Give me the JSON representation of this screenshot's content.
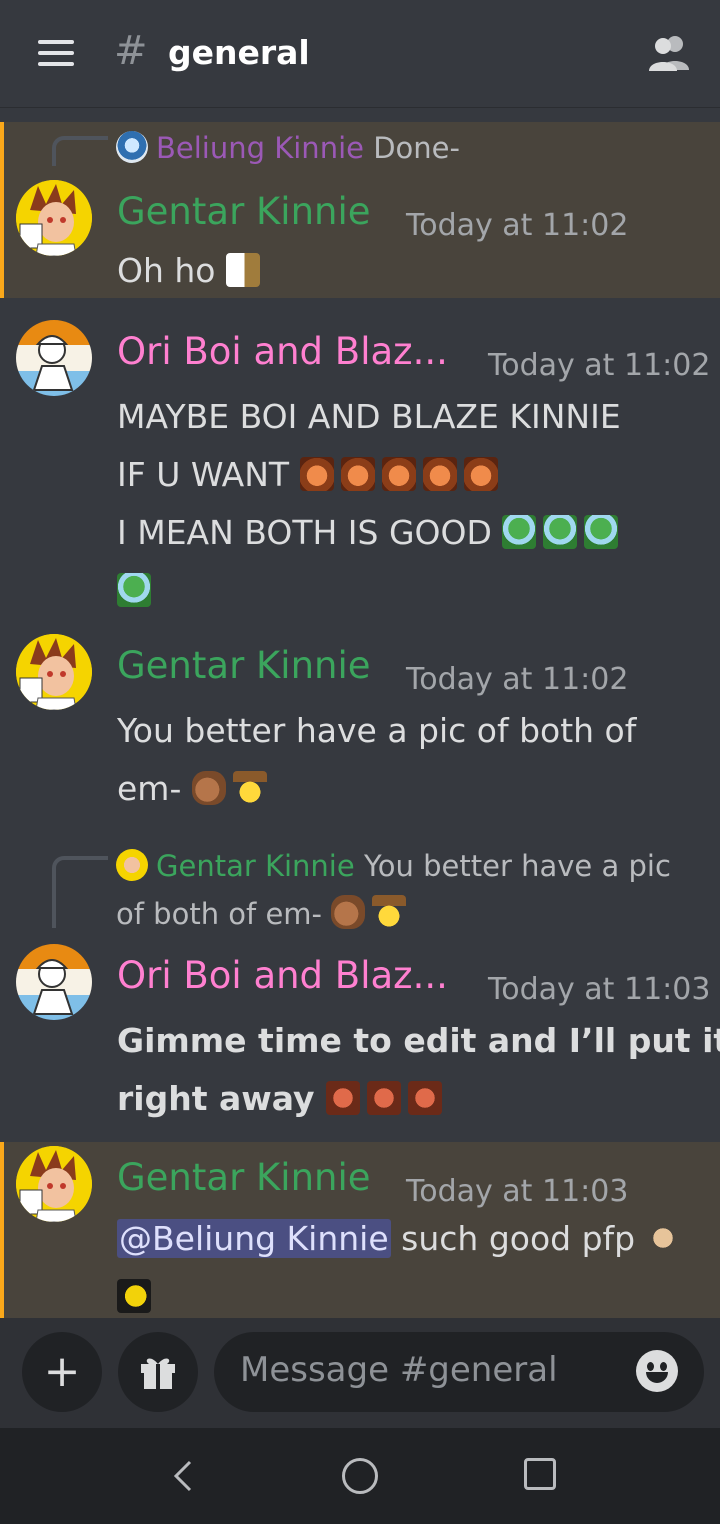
{
  "header": {
    "channel_hash": "#",
    "channel_name": "general"
  },
  "messages": [
    {
      "reply": {
        "author": "Beliung Kinnie",
        "text": "Done-"
      },
      "author": "Gentar Kinnie",
      "timestamp": "Today at 11:02",
      "lines": [
        "Oh ho"
      ]
    },
    {
      "author": "Ori Boi and Blaz...",
      "timestamp": "Today at 11:02",
      "lines": [
        "MAYBE BOI AND BLAZE KINNIE",
        "IF U WANT",
        "I MEAN BOTH IS GOOD"
      ]
    },
    {
      "author": "Gentar Kinnie",
      "timestamp": "Today at 11:02",
      "lines": [
        "You better have a pic of both of",
        "em-"
      ]
    },
    {
      "reply": {
        "author": "Gentar Kinnie",
        "text_line1": "You better have a pic",
        "text_line2": "of both of em-"
      },
      "author": "Ori Boi and Blaz...",
      "timestamp": "Today at 11:03",
      "lines": [
        "Gimme time to edit and I’ll put it",
        "right away"
      ]
    },
    {
      "author": "Gentar Kinnie",
      "timestamp": "Today at 11:03",
      "mention": "@Beliung Kinnie",
      "lines": [
        "such good pfp"
      ]
    }
  ],
  "composer": {
    "placeholder": "Message #general",
    "add_label": "+"
  },
  "colors": {
    "background": "#36393f",
    "highlight": "#49443c",
    "highlight_bar": "#faa81a",
    "green_name": "#3ba55d",
    "pink_name": "#ff80d0",
    "mention_bg": "#4b4f82"
  }
}
